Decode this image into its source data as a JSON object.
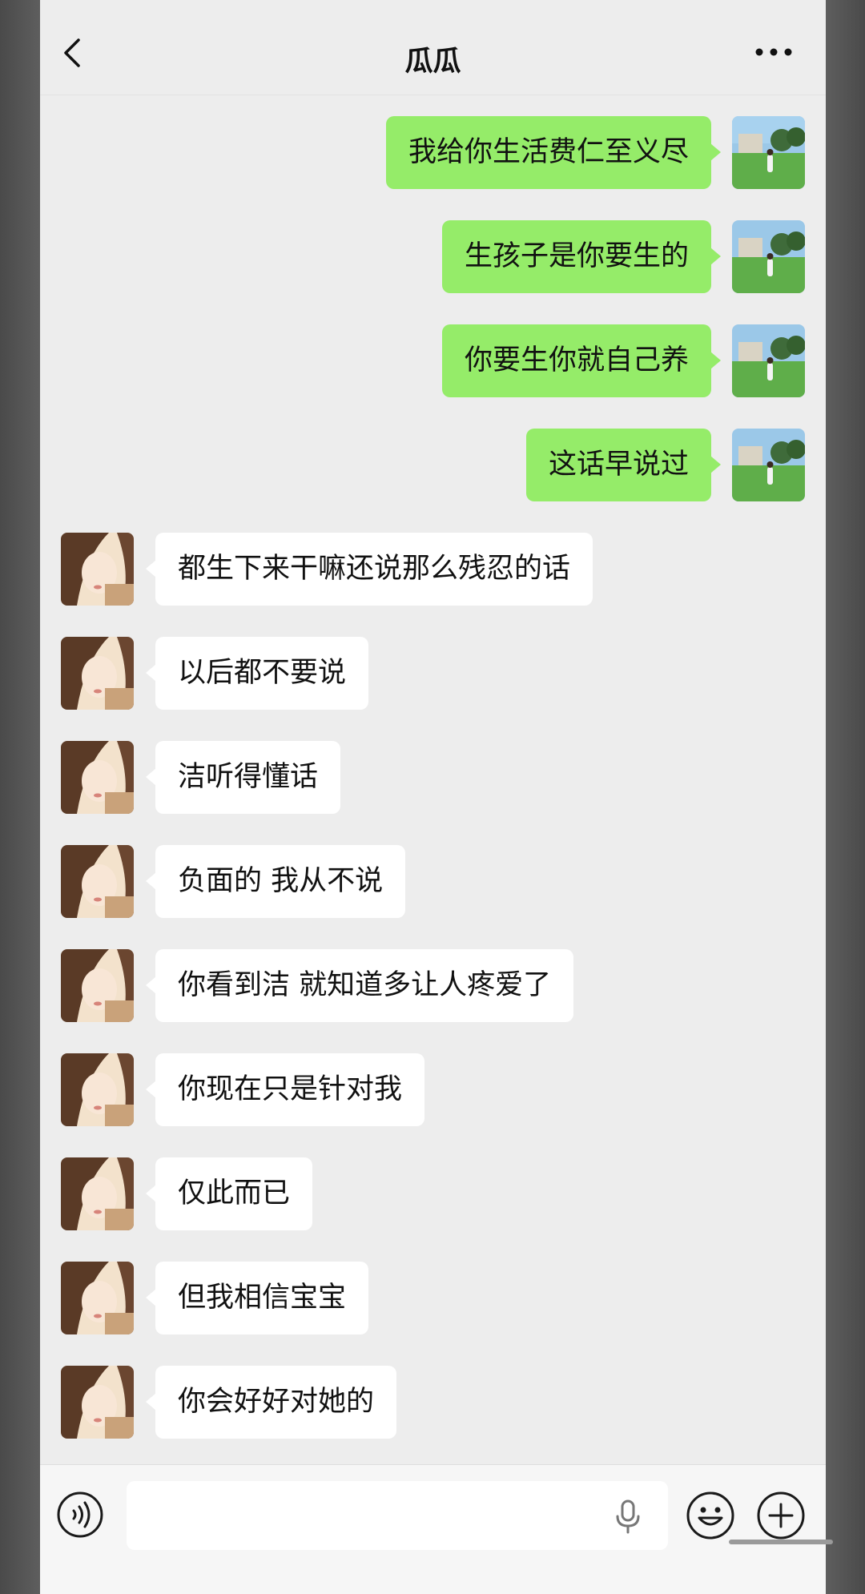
{
  "header": {
    "title": "瓜瓜"
  },
  "messages": [
    {
      "side": "out",
      "text": "我给你生活费仁至义尽"
    },
    {
      "side": "out",
      "text": "生孩子是你要生的"
    },
    {
      "side": "out",
      "text": "你要生你就自己养"
    },
    {
      "side": "out",
      "text": "这话早说过"
    },
    {
      "side": "in",
      "text": "都生下来干嘛还说那么残忍的话"
    },
    {
      "side": "in",
      "text": "以后都不要说"
    },
    {
      "side": "in",
      "text": "洁听得懂话"
    },
    {
      "side": "in",
      "text": "负面的 我从不说"
    },
    {
      "side": "in",
      "text": "你看到洁 就知道多让人疼爱了"
    },
    {
      "side": "in",
      "text": "你现在只是针对我"
    },
    {
      "side": "in",
      "text": "仅此而已"
    },
    {
      "side": "in",
      "text": "但我相信宝宝"
    },
    {
      "side": "in",
      "text": "你会好好对她的"
    }
  ],
  "icons": {
    "back": "chevron-left-icon",
    "more": "more-dots-icon",
    "voice": "voice-icon",
    "mic": "microphone-icon",
    "emoji": "emoji-icon",
    "plus": "plus-icon"
  },
  "colors": {
    "outgoing_bubble": "#95ec69",
    "incoming_bubble": "#ffffff",
    "background": "#ededed"
  },
  "input": {
    "value": ""
  }
}
